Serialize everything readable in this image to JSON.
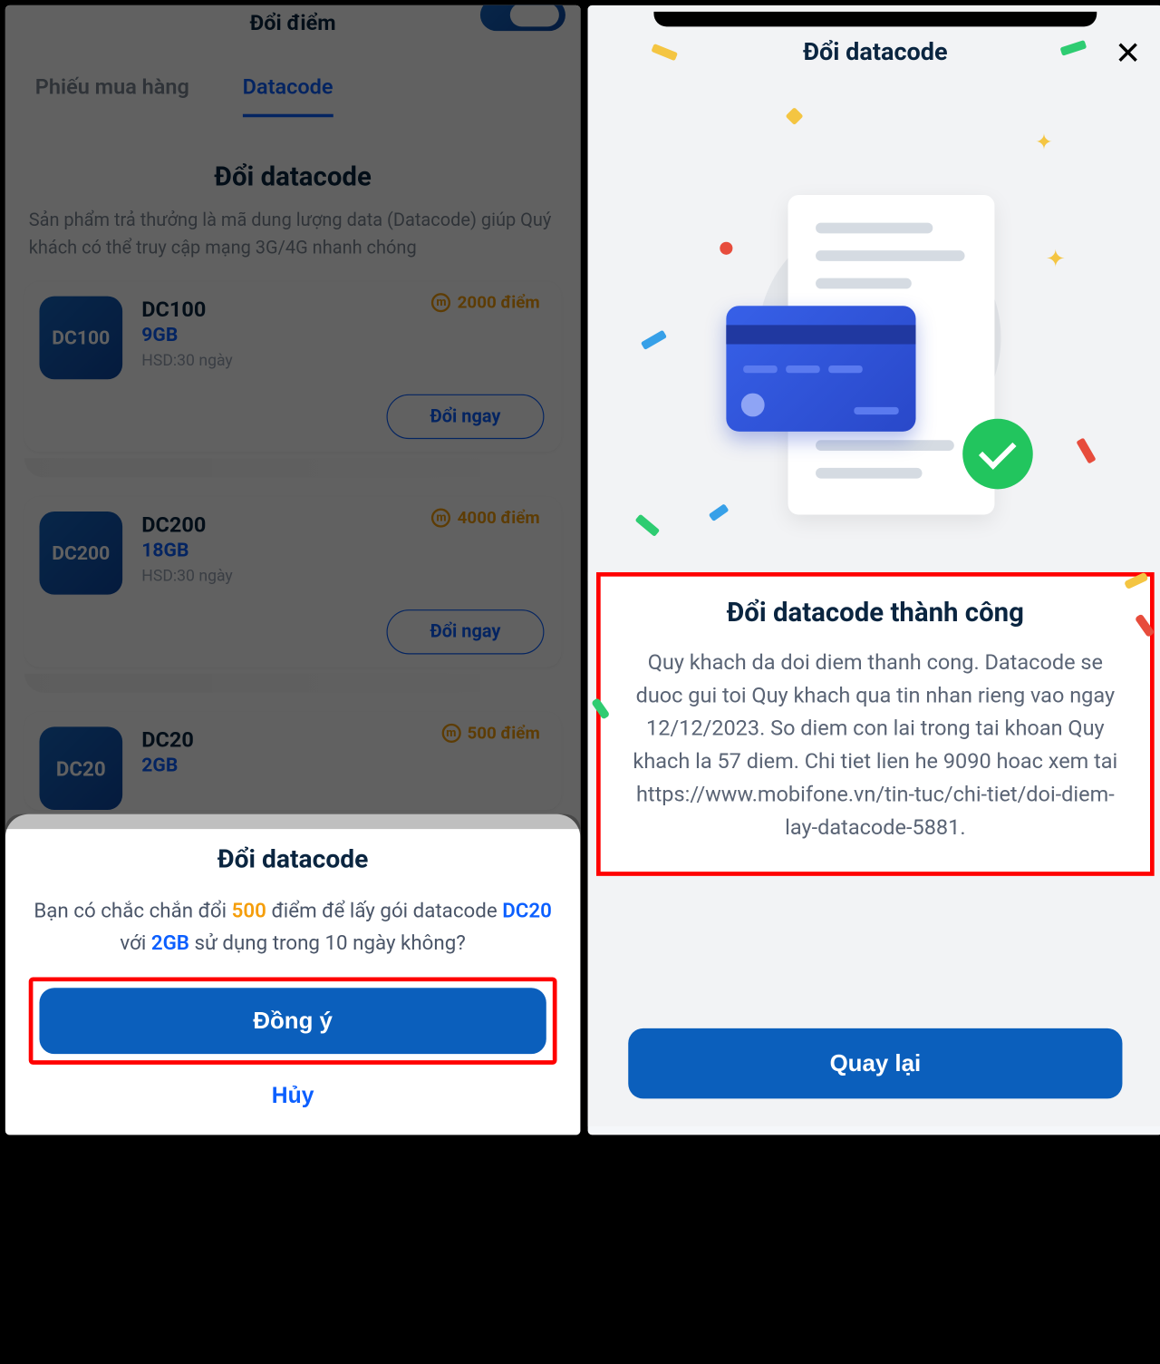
{
  "left": {
    "header_title": "Đổi điểm",
    "tabs": {
      "voucher": "Phiếu mua hàng",
      "datacode": "Datacode"
    },
    "section_title": "Đổi datacode",
    "section_desc": "Sản phẩm trả thưởng là mã dung lượng data (Datacode) giúp Quý khách có thể truy cập mạng 3G/4G nhanh chóng",
    "products": [
      {
        "code": "DC100",
        "name": "DC100",
        "cap": "9GB",
        "exp": "HSD:30 ngày",
        "points": "2000 điểm",
        "btn": "Đổi ngay"
      },
      {
        "code": "DC200",
        "name": "DC200",
        "cap": "18GB",
        "exp": "HSD:30 ngày",
        "points": "4000 điểm",
        "btn": "Đổi ngay"
      },
      {
        "code": "DC20",
        "name": "DC20",
        "cap": "2GB",
        "exp": "",
        "points": "500 điểm",
        "btn": ""
      }
    ],
    "sheet": {
      "title": "Đổi datacode",
      "body_prefix": "Bạn có chắc chắn đổi ",
      "points": "500",
      "body_mid1": " điểm để lấy gói datacode ",
      "code": "DC20",
      "body_mid2": " với ",
      "cap": "2GB",
      "body_suffix": " sử dụng trong 10 ngày không?",
      "confirm": "Đồng ý",
      "cancel": "Hủy"
    }
  },
  "right": {
    "title": "Đổi datacode",
    "success_title": "Đổi datacode thành công",
    "success_text": "Quy khach da doi diem thanh cong. Datacode se duoc gui toi Quy khach qua tin nhan rieng vao ngay 12/12/2023. So diem con lai trong tai khoan Quy khach la 57 diem. Chi tiet lien he 9090 hoac xem tai https://www.mobifone.vn/tin-tuc/chi-tiet/doi-diem-lay-datacode-5881.",
    "back": "Quay lại"
  }
}
